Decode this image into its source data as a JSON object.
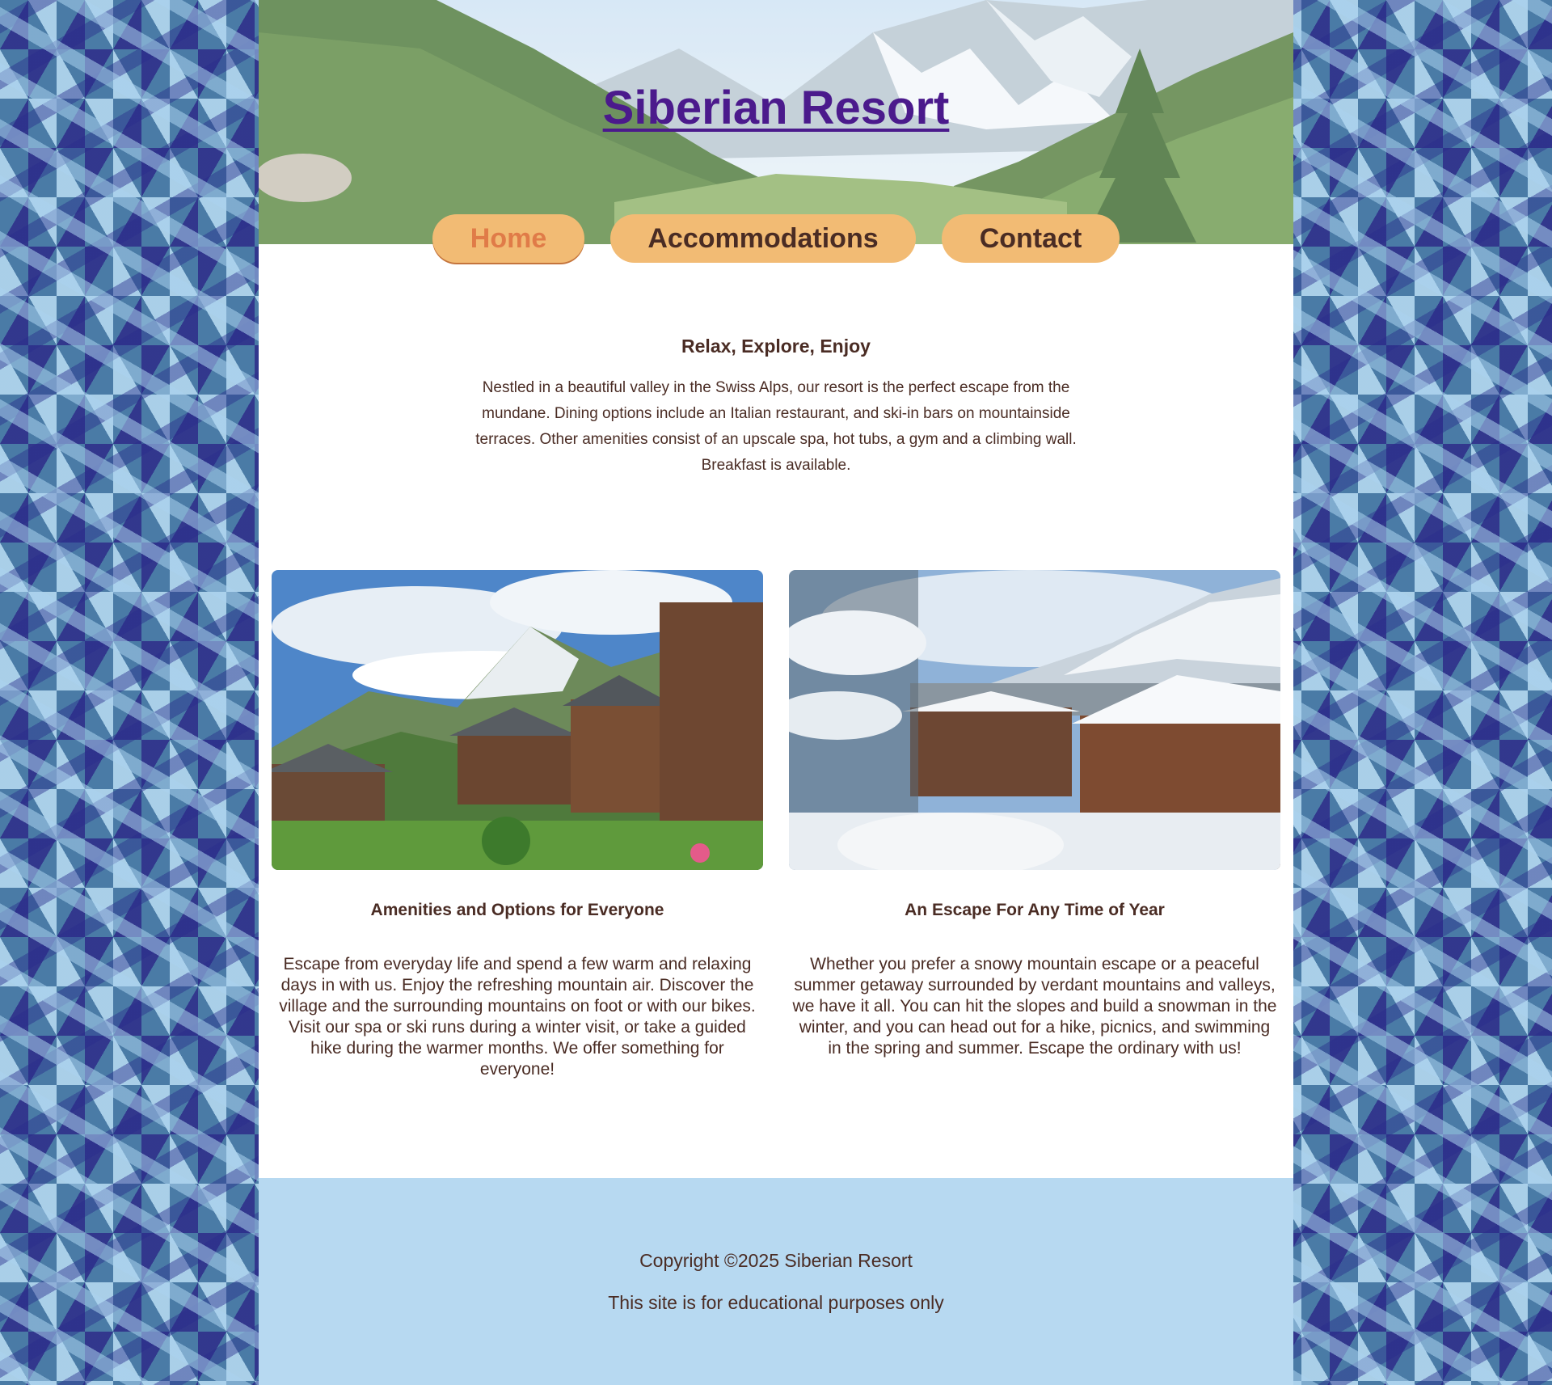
{
  "site": {
    "title": "Siberian Resort"
  },
  "nav": {
    "items": [
      {
        "label": "Home",
        "active": true
      },
      {
        "label": "Accommodations",
        "active": false
      },
      {
        "label": "Contact",
        "active": false
      }
    ]
  },
  "intro": {
    "heading": "Relax, Explore, Enjoy",
    "body": "Nestled in a beautiful valley in the Swiss Alps, our resort is the perfect escape from the mundane. Dining options include an Italian restaurant, and ski-in bars on mountainside terraces. Other amenities consist of an upscale spa, hot tubs, a gym and a climbing wall. Breakfast is available."
  },
  "cards": [
    {
      "heading": "Amenities and Options for Everyone",
      "body": "Escape from everyday life and spend a few warm and relaxing days in with us. Enjoy the refreshing mountain air. Discover the village and the surrounding mountains on foot or with our bikes. Visit our spa or ski runs during a winter visit, or take a guided hike during the warmer months. We offer something for everyone!"
    },
    {
      "heading": "An Escape For Any Time of Year",
      "body": "Whether you prefer a snowy mountain escape or a peaceful summer getaway surrounded by verdant mountains and valleys, we have it all. You can hit the slopes and build a snowman in the winter, and you can head out for a hike, picnics, and swimming in the spring and summer. Escape the ordinary with us!"
    }
  ],
  "footer": {
    "copyright": "Copyright ©2025 Siberian Resort",
    "note": "This site is for educational purposes only"
  },
  "colors": {
    "title": "#4b1a8c",
    "nav_bg": "#f2bb74",
    "nav_active_text": "#e07b48",
    "text": "#4a2c24",
    "footer_bg": "#b7d9f1",
    "pattern_dark": "#31348c",
    "pattern_mid": "#4a7ba6",
    "pattern_light": "#b4d8f0"
  }
}
